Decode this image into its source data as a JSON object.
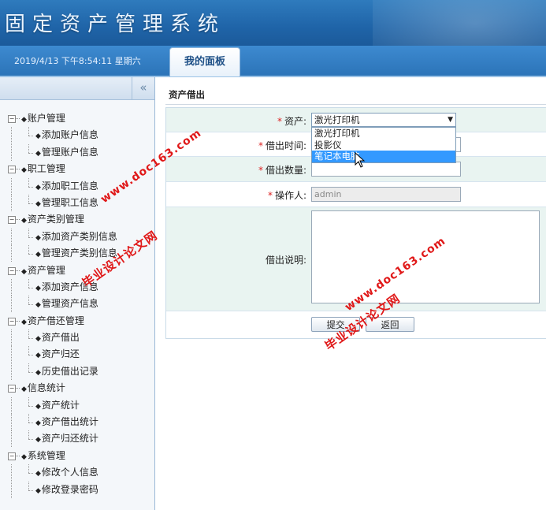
{
  "header": {
    "app_title": "固定资产管理系统",
    "datetime": "2019/4/13 下午8:54:11 星期六",
    "tab_label": "我的面板"
  },
  "sidebar": {
    "collapse_icon": "double-chevron-left-icon",
    "groups": [
      {
        "label": "账户管理",
        "items": [
          "添加账户信息",
          "管理账户信息"
        ]
      },
      {
        "label": "职工管理",
        "items": [
          "添加职工信息",
          "管理职工信息"
        ]
      },
      {
        "label": "资产类别管理",
        "items": [
          "添加资产类别信息",
          "管理资产类别信息"
        ]
      },
      {
        "label": "资产管理",
        "items": [
          "添加资产信息",
          "管理资产信息"
        ]
      },
      {
        "label": "资产借还管理",
        "items": [
          "资产借出",
          "资产归还",
          "历史借出记录"
        ]
      },
      {
        "label": "信息统计",
        "items": [
          "资产统计",
          "资产借出统计",
          "资产归还统计"
        ]
      },
      {
        "label": "系统管理",
        "items": [
          "修改个人信息",
          "修改登录密码"
        ]
      }
    ]
  },
  "main": {
    "section_title": "资产借出",
    "form": {
      "asset_label": "资产:",
      "asset_selected": "激光打印机",
      "asset_options": [
        "激光打印机",
        "投影仪",
        "笔记本电脑"
      ],
      "asset_highlighted": "笔记本电脑",
      "borrow_time_label": "借出时间:",
      "borrow_time_value": "",
      "borrow_qty_label": "借出数量:",
      "borrow_qty_value": "",
      "operator_label": "操作人:",
      "operator_value": "admin",
      "remark_label": "借出说明:",
      "remark_value": "",
      "submit_label": "提交",
      "back_label": "返回"
    }
  },
  "watermarks": {
    "url": "www.doc163.com",
    "text": "毕业设计论文网"
  },
  "colors": {
    "header_blue": "#1f64a8",
    "required_red": "#d22222",
    "row_tint": "#e9f4f1",
    "selected_option": "#3399ff",
    "watermark_red": "#e01818"
  }
}
